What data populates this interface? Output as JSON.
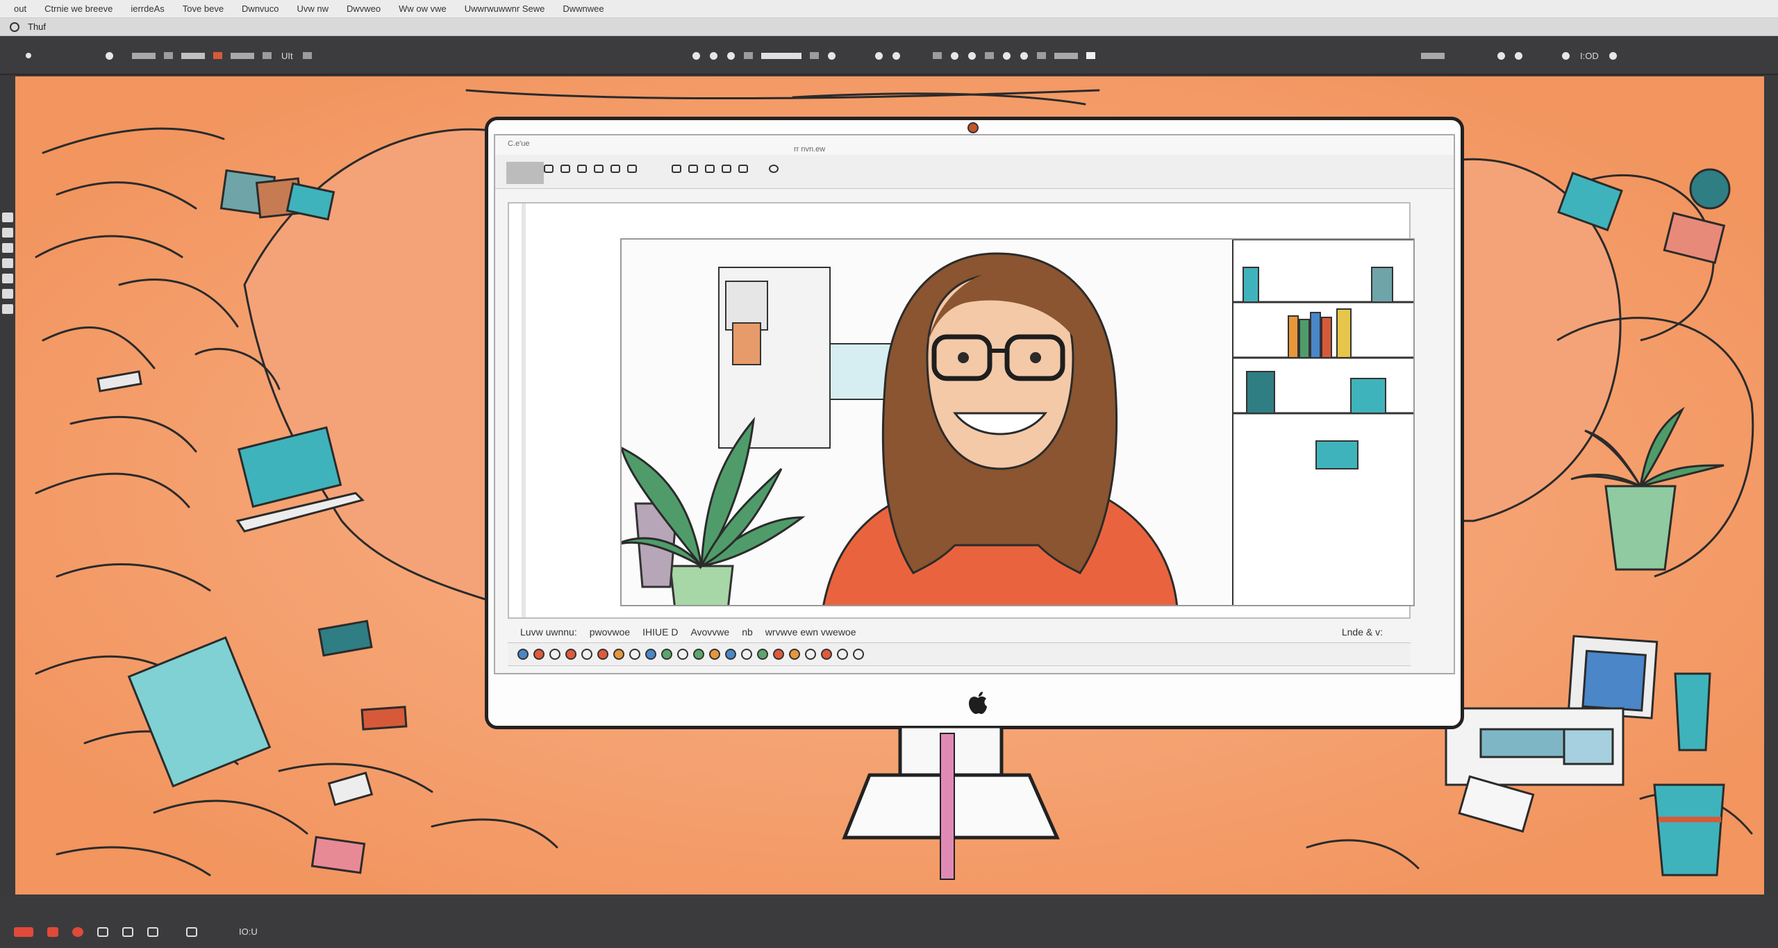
{
  "menubar": {
    "items": [
      "out",
      "Ctrnie we breeve",
      "ierrdeAs",
      "Tove beve",
      "Dwnvuco",
      "Uvw nw",
      "Dwvweo",
      "Ww ow vwe",
      "Uwwrwuwwnr Sewe",
      "Dwwnwee"
    ]
  },
  "pathbar": {
    "label": "Thuf"
  },
  "toolbar": {
    "text_1": "UIt",
    "text_2": "I:OD"
  },
  "screen": {
    "title_left": "C.e'ue",
    "title_right": "rr nvn.ew",
    "status_items": [
      "Luvw  uwnnu:",
      "pwovwoe",
      "IHIUE  D",
      "Avovvwe",
      "nb",
      "wrvwve  ewn  vwewoe"
    ],
    "status_right": "Lnde  & v:"
  },
  "colors": {
    "background": "#f3a77c",
    "toolbar": "#3c3c3e",
    "accent_teal": "#3fb3bb",
    "accent_red": "#e05a3a"
  },
  "bottombar": {
    "text": "IO:U"
  },
  "icons": [
    "apple-logo-icon",
    "camera-icon",
    "search-icon",
    "gear-icon",
    "close-icon"
  ]
}
